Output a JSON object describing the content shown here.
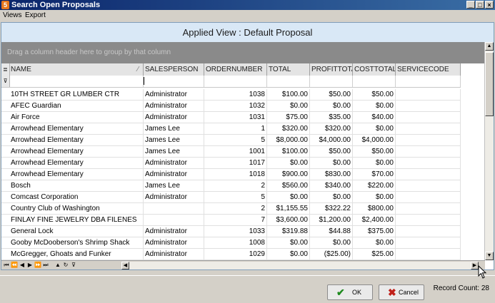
{
  "window": {
    "title": "Search Open Proposals",
    "icon_glyph": "5"
  },
  "menu": [
    "Views",
    "Export"
  ],
  "grid": {
    "view_title": "Applied View : Default Proposal",
    "group_hint": "Drag a column header here to group by that column",
    "columns": [
      "NAME",
      "SALESPERSON",
      "ORDERNUMBER",
      "TOTAL",
      "PROFITTOTA",
      "COSTTOTAL",
      "SERVICECODE"
    ],
    "rows": [
      [
        "10TH STREET GR LUMBER CTR",
        "Administrator",
        "1038",
        "$100.00",
        "$50.00",
        "$50.00",
        ""
      ],
      [
        "AFEC Guardian",
        "Administrator",
        "1032",
        "$0.00",
        "$0.00",
        "$0.00",
        ""
      ],
      [
        "Air Force",
        "Administrator",
        "1031",
        "$75.00",
        "$35.00",
        "$40.00",
        ""
      ],
      [
        "Arrowhead Elementary",
        "James Lee",
        "1",
        "$320.00",
        "$320.00",
        "$0.00",
        ""
      ],
      [
        "Arrowhead Elementary",
        "James Lee",
        "5",
        "$8,000.00",
        "$4,000.00",
        "$4,000.00",
        ""
      ],
      [
        "Arrowhead Elementary",
        "James Lee",
        "1001",
        "$100.00",
        "$50.00",
        "$50.00",
        ""
      ],
      [
        "Arrowhead Elementary",
        "Administrator",
        "1017",
        "$0.00",
        "$0.00",
        "$0.00",
        ""
      ],
      [
        "Arrowhead Elementary",
        "Administrator",
        "1018",
        "$900.00",
        "$830.00",
        "$70.00",
        ""
      ],
      [
        "Bosch",
        "James Lee",
        "2",
        "$560.00",
        "$340.00",
        "$220.00",
        ""
      ],
      [
        "Comcast Corporation",
        "Administrator",
        "5",
        "$0.00",
        "$0.00",
        "$0.00",
        ""
      ],
      [
        "Country Club of Washington",
        "",
        "2",
        "$1,155.55",
        "$322.22",
        "$800.00",
        ""
      ],
      [
        "FINLAY FINE JEWELRY DBA FILENES",
        "",
        "7",
        "$3,600.00",
        "$1,200.00",
        "$2,400.00",
        ""
      ],
      [
        "General Lock",
        "Administrator",
        "1033",
        "$319.88",
        "$44.88",
        "$375.00",
        ""
      ],
      [
        "Gooby McDooberson's Shrimp Shack",
        "Administrator",
        "1008",
        "$0.00",
        "$0.00",
        "$0.00",
        ""
      ],
      [
        "McGregger, Ghoats and Funker",
        "Administrator",
        "1029",
        "$0.00",
        "($25.00)",
        "$25.00",
        ""
      ]
    ]
  },
  "buttons": {
    "ok": "OK",
    "cancel": "Cancel"
  },
  "record_count": "Record Count: 28"
}
